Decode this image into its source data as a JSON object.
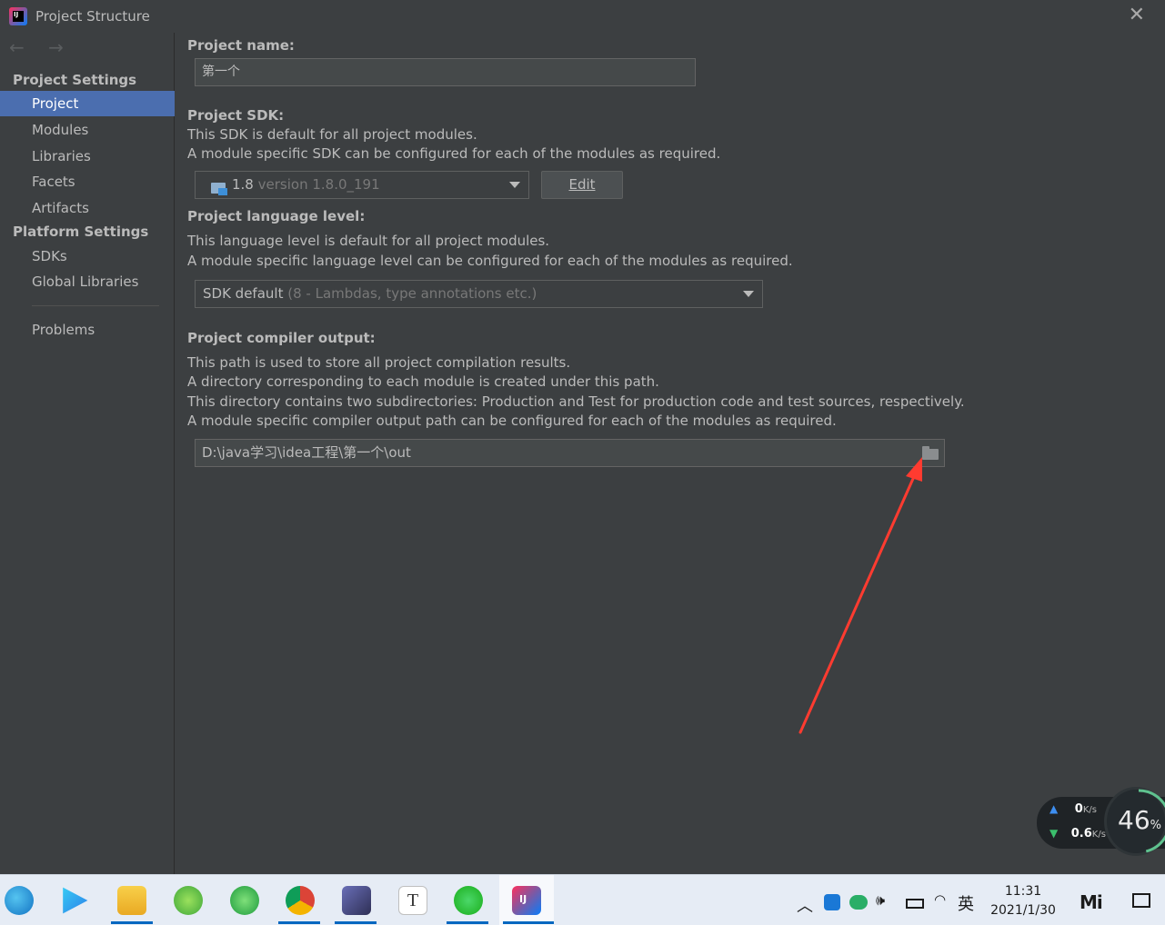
{
  "window": {
    "title": "Project Structure",
    "close_glyph": "✕"
  },
  "sidebar": {
    "nav_arrows": "← →",
    "project_settings_header": "Project Settings",
    "project_items": [
      {
        "label": "Project",
        "selected": true
      },
      {
        "label": "Modules",
        "selected": false
      },
      {
        "label": "Libraries",
        "selected": false
      },
      {
        "label": "Facets",
        "selected": false
      },
      {
        "label": "Artifacts",
        "selected": false
      }
    ],
    "platform_settings_header": "Platform Settings",
    "platform_items": [
      {
        "label": "SDKs"
      },
      {
        "label": "Global Libraries"
      }
    ],
    "problems_label": "Problems"
  },
  "content": {
    "project_name_label": "Project name:",
    "project_name_value": "第一个",
    "sdk_label": "Project SDK:",
    "sdk_desc_1": "This SDK is default for all project modules.",
    "sdk_desc_2": "A module specific SDK can be configured for each of the modules as required.",
    "sdk_selected_main": "1.8",
    "sdk_selected_muted": "version 1.8.0_191",
    "sdk_edit_button": "Edit",
    "lang_label": "Project language level:",
    "lang_desc_1": "This language level is default for all project modules.",
    "lang_desc_2": "A module specific language level can be configured for each of the modules as required.",
    "lang_selected_main": "SDK default",
    "lang_selected_muted": "(8 - Lambdas, type annotations etc.)",
    "output_label": "Project compiler output:",
    "output_desc_1": "This path is used to store all project compilation results.",
    "output_desc_2": "A directory corresponding to each module is created under this path.",
    "output_desc_3": "This directory contains two subdirectories: Production and Test for production code and test sources, respectively.",
    "output_desc_4": "A module specific compiler output path can be configured for each of the modules as required.",
    "output_path": "D:\\java学习\\idea工程\\第一个\\out"
  },
  "annotation": {
    "arrow_color": "#ff3b30"
  },
  "net_monitor": {
    "up_value": "0",
    "up_unit": "K/s",
    "down_value": "0.6",
    "down_unit": "K/s",
    "cpu_value": "46",
    "cpu_unit": "%",
    "cpu_level": 0.46
  },
  "taskbar": {
    "apps": [
      {
        "name": "edge-icon"
      },
      {
        "name": "video-player-icon"
      },
      {
        "name": "file-explorer-icon"
      },
      {
        "name": "green-app-icon"
      },
      {
        "name": "ie-icon"
      },
      {
        "name": "chrome-icon"
      },
      {
        "name": "photo-app-icon"
      },
      {
        "name": "typora-icon",
        "glyph": "T"
      },
      {
        "name": "wechat-icon"
      },
      {
        "name": "intellij-icon",
        "glyph": "IJ"
      }
    ],
    "ime_label": "英",
    "clock_time": "11:31",
    "clock_date": "2021/1/30",
    "mi_label": "Mi"
  },
  "colors": {
    "selection": "#4b6eaf",
    "background": "#3c3f41",
    "taskbar": "#e6ecf5"
  }
}
